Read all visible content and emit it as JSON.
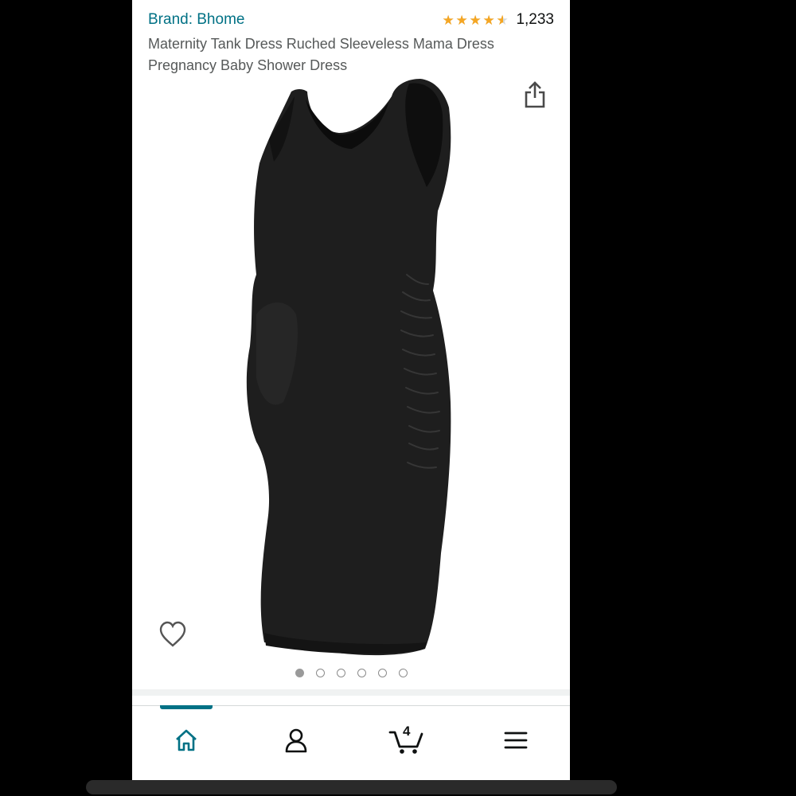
{
  "product": {
    "brand": "Brand: Bhome",
    "rating_value": 4.5,
    "rating_count": "1,233",
    "title": "Maternity Tank Dress Ruched Sleeveless Mama Dress Pregnancy Baby Shower Dress"
  },
  "gallery": {
    "image_count": 6,
    "active_index": 0,
    "dress_color": "#1f1f1f"
  },
  "icons": {
    "share": "share-icon",
    "wishlist": "heart-icon",
    "home": "home-icon",
    "account": "account-icon",
    "cart": "cart-icon",
    "menu": "menu-icon"
  },
  "nav": {
    "cart_count": "4",
    "active_tab": "home"
  },
  "colors": {
    "link": "#007185",
    "star": "#f5a623",
    "text": "#0f1111",
    "secondary_text": "#565959"
  }
}
